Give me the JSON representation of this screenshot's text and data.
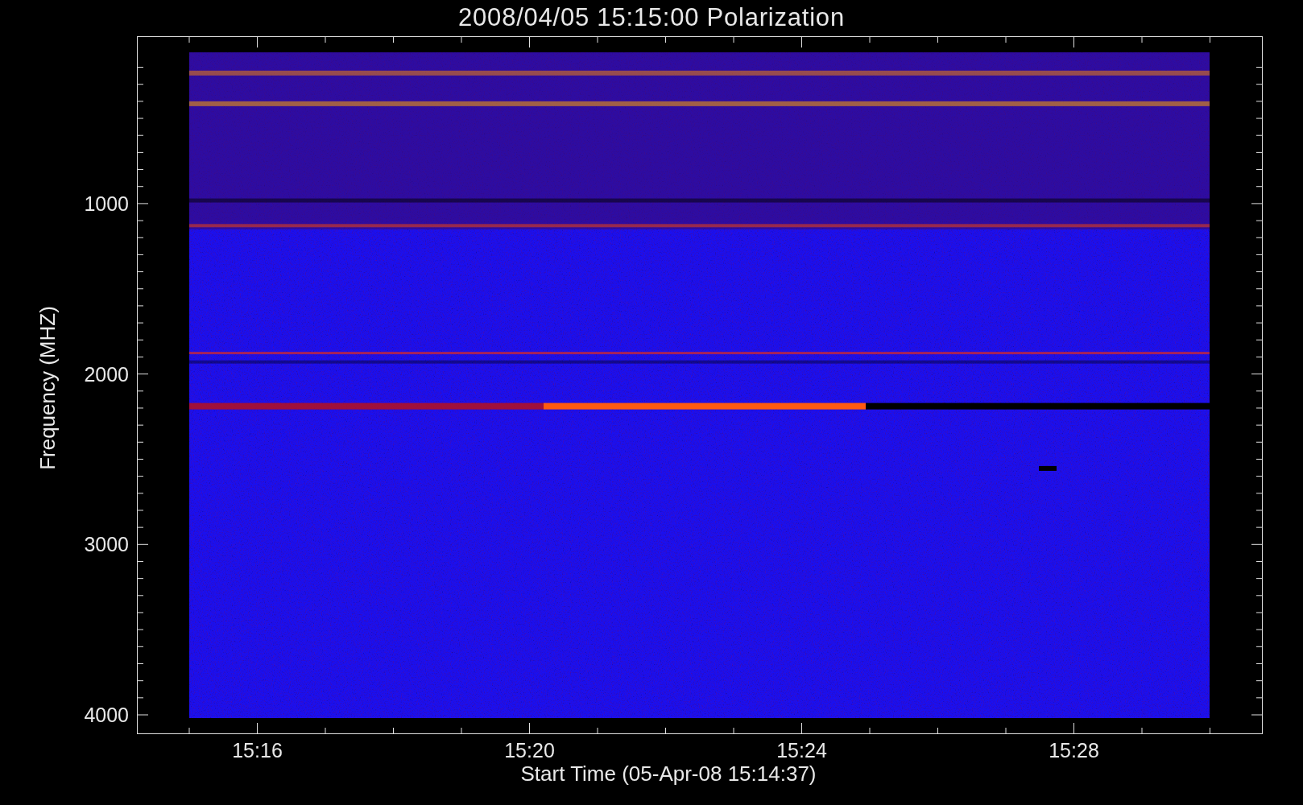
{
  "title": "2008/04/05 15:15:00 Polarization",
  "y_axis": {
    "label": "Frequency (MHZ)",
    "ticks": [
      "1000",
      "2000",
      "3000",
      "4000"
    ]
  },
  "x_axis": {
    "label": "Start Time (05-Apr-08 15:14:37)",
    "ticks": [
      "15:16",
      "15:20",
      "15:24",
      "15:28"
    ]
  }
}
